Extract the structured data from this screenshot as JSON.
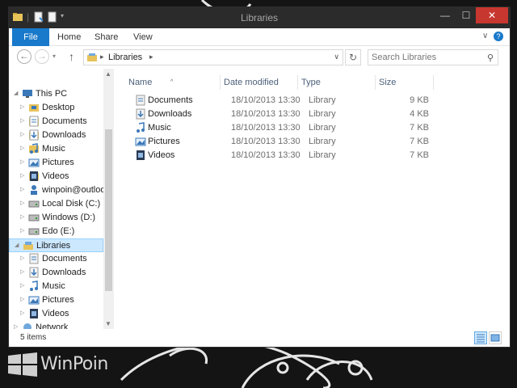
{
  "window": {
    "title": "Libraries"
  },
  "ribbon": {
    "tabs": [
      "File",
      "Home",
      "Share",
      "View"
    ]
  },
  "address": {
    "crumbs": [
      "Libraries"
    ],
    "search_placeholder": "Search Libraries"
  },
  "nav_tree": [
    {
      "label": "This PC",
      "level": 0,
      "icon": "computer-icon",
      "expanded": true
    },
    {
      "label": "Desktop",
      "level": 1,
      "icon": "desktop-folder-icon"
    },
    {
      "label": "Documents",
      "level": 1,
      "icon": "documents-folder-icon"
    },
    {
      "label": "Downloads",
      "level": 1,
      "icon": "downloads-folder-icon"
    },
    {
      "label": "Music",
      "level": 1,
      "icon": "music-folder-icon"
    },
    {
      "label": "Pictures",
      "level": 1,
      "icon": "pictures-folder-icon"
    },
    {
      "label": "Videos",
      "level": 1,
      "icon": "videos-folder-icon"
    },
    {
      "label": "winpoin@outlook",
      "level": 1,
      "icon": "user-icon"
    },
    {
      "label": "Local Disk (C:)",
      "level": 1,
      "icon": "drive-icon"
    },
    {
      "label": "Windows (D:)",
      "level": 1,
      "icon": "drive-icon"
    },
    {
      "label": "Edo (E:)",
      "level": 1,
      "icon": "drive-icon"
    },
    {
      "label": "Libraries",
      "level": 0,
      "icon": "libraries-icon",
      "expanded": true,
      "selected": true
    },
    {
      "label": "Documents",
      "level": 1,
      "icon": "documents-library-icon"
    },
    {
      "label": "Downloads",
      "level": 1,
      "icon": "downloads-library-icon"
    },
    {
      "label": "Music",
      "level": 1,
      "icon": "music-library-icon"
    },
    {
      "label": "Pictures",
      "level": 1,
      "icon": "pictures-library-icon"
    },
    {
      "label": "Videos",
      "level": 1,
      "icon": "videos-library-icon"
    },
    {
      "label": "Network",
      "level": 0,
      "icon": "network-icon"
    }
  ],
  "columns": {
    "name": "Name",
    "date": "Date modified",
    "type": "Type",
    "size": "Size"
  },
  "files": [
    {
      "name": "Documents",
      "date": "18/10/2013 13:30",
      "type": "Library",
      "size": "9 KB",
      "icon": "documents-library-icon"
    },
    {
      "name": "Downloads",
      "date": "18/10/2013 13:30",
      "type": "Library",
      "size": "4 KB",
      "icon": "downloads-library-icon"
    },
    {
      "name": "Music",
      "date": "18/10/2013 13:30",
      "type": "Library",
      "size": "7 KB",
      "icon": "music-library-icon"
    },
    {
      "name": "Pictures",
      "date": "18/10/2013 13:30",
      "type": "Library",
      "size": "7 KB",
      "icon": "pictures-library-icon"
    },
    {
      "name": "Videos",
      "date": "18/10/2013 13:30",
      "type": "Library",
      "size": "7 KB",
      "icon": "videos-library-icon"
    }
  ],
  "status": {
    "item_count": "5 items"
  },
  "watermark": {
    "brand": "WinPoin"
  }
}
